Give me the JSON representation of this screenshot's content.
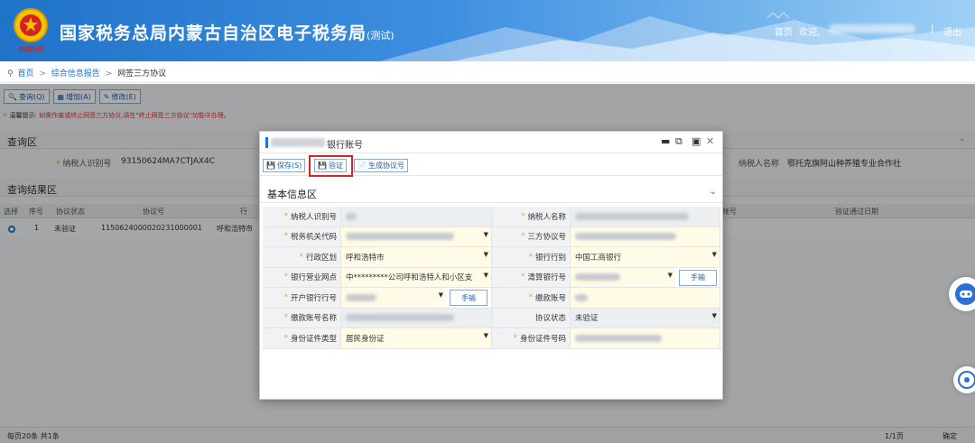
{
  "header": {
    "title": "国家税务总局内蒙古自治区电子税务局",
    "title_suffix": "(测试)",
    "emblem_text": "中国税务",
    "home_link": "首页",
    "welcome": "欢迎,",
    "logout": "退出",
    "separator": "|"
  },
  "breadcrumb": {
    "home": "首页",
    "level1": "综合信息报告",
    "level2": "网签三方协议",
    "sep": ">"
  },
  "background": {
    "toolbar": [
      "查询(Q)",
      "增加(A)",
      "修改(E)"
    ],
    "tip_prefix": "温馨提示",
    "tip_text": "如需作废或终止网签三方协议,请在",
    "tip_red": "\"终止网签三方协议\"功能中办理。",
    "query_section": "查询区",
    "taxpayer_id_label": "纳税人识别号",
    "taxpayer_id_value": "93150624MA7CTJAX4C",
    "taxpayer_name_label": "纳税人名称",
    "taxpayer_name_value": "鄂托克旗阿山种养殖专业合作社",
    "result_section": "查询结果区",
    "grid_headers": [
      "选择",
      "序号",
      "协议状态",
      "协议号",
      "行",
      "帐号",
      "验证通过日期"
    ],
    "grid_row": {
      "seq": "1",
      "status": "未验证",
      "protocol": "1150624000020231000001",
      "bank": "呼和浩特市"
    },
    "pager_left": "每页20条  共1条",
    "pager_right": "1/1页",
    "pager_confirm": "确定"
  },
  "modal": {
    "title": "银行账号",
    "buttons": {
      "save": "保存(S)",
      "verify": "验证",
      "generate": "生成协议号"
    },
    "section": "基本信息区",
    "fields": {
      "taxpayer_id": {
        "label": "纳税人识别号",
        "required": true
      },
      "taxpayer_name": {
        "label": "纳税人名称",
        "required": true
      },
      "tax_office": {
        "label": "税务机关代码",
        "required": true
      },
      "tripartite_no": {
        "label": "三方协议号",
        "required": true
      },
      "region": {
        "label": "行政区划",
        "required": true,
        "value": "呼和浩特市"
      },
      "bank_type": {
        "label": "银行行别",
        "required": true,
        "value": "中国工商银行"
      },
      "bank_branch": {
        "label": "银行营业网点",
        "required": true,
        "value": "中*********公司呼和浩特人和小区支"
      },
      "clearing_bank": {
        "label": "清算银行号",
        "required": true
      },
      "open_bank": {
        "label": "开户银行行号",
        "required": true
      },
      "pay_account": {
        "label": "缴款账号",
        "required": true
      },
      "pay_account_name": {
        "label": "缴款账号名称",
        "required": true
      },
      "protocol_status": {
        "label": "协议状态",
        "required": false,
        "value": "未验证"
      },
      "id_type": {
        "label": "身份证件类型",
        "required": true,
        "value": "居民身份证"
      },
      "id_number": {
        "label": "身份证件号码",
        "required": true
      }
    },
    "manual_input": "手输",
    "required_mark": "*"
  },
  "colors": {
    "primary": "#1f73c8",
    "required": "#e6a23c",
    "highlight": "#e02020",
    "input_yellow": "#fffbe6"
  }
}
